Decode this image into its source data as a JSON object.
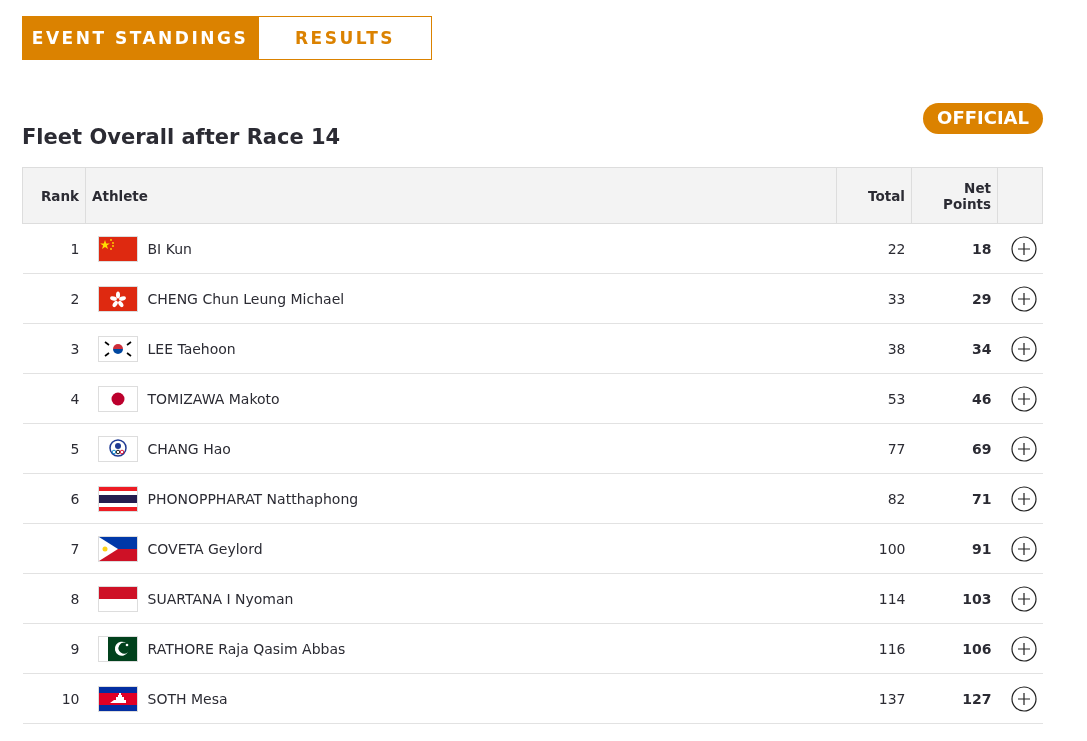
{
  "tabs": [
    {
      "label": "EVENT STANDINGS",
      "selected": true
    },
    {
      "label": "RESULTS",
      "selected": false
    }
  ],
  "status_badge": "OFFICIAL",
  "title": "Fleet Overall after Race 14",
  "table": {
    "columns": [
      "Rank",
      "Athlete",
      "Total",
      "Net Points"
    ],
    "rows": [
      {
        "rank": "1",
        "kind": "china",
        "athlete": "BI Kun",
        "total": "22",
        "net": "18"
      },
      {
        "rank": "2",
        "kind": "hongkong",
        "athlete": "CHENG Chun Leung Michael",
        "total": "33",
        "net": "29"
      },
      {
        "rank": "3",
        "kind": "korea",
        "athlete": "LEE Taehoon",
        "total": "38",
        "net": "34"
      },
      {
        "rank": "4",
        "kind": "japan",
        "athlete": "TOMIZAWA Makoto",
        "total": "53",
        "net": "46"
      },
      {
        "rank": "5",
        "kind": "emblem",
        "athlete": "CHANG Hao",
        "total": "77",
        "net": "69"
      },
      {
        "rank": "6",
        "kind": "thailand",
        "athlete": "PHONOPPHARAT Natthaphong",
        "total": "82",
        "net": "71"
      },
      {
        "rank": "7",
        "kind": "philippines",
        "athlete": "COVETA Geylord",
        "total": "100",
        "net": "91"
      },
      {
        "rank": "8",
        "kind": "indonesia",
        "athlete": "SUARTANA I Nyoman",
        "total": "114",
        "net": "103"
      },
      {
        "rank": "9",
        "kind": "pakistan",
        "athlete": "RATHORE Raja Qasim Abbas",
        "total": "116",
        "net": "106"
      },
      {
        "rank": "10",
        "kind": "cambodia",
        "athlete": "SOTH Mesa",
        "total": "137",
        "net": "127"
      }
    ]
  }
}
